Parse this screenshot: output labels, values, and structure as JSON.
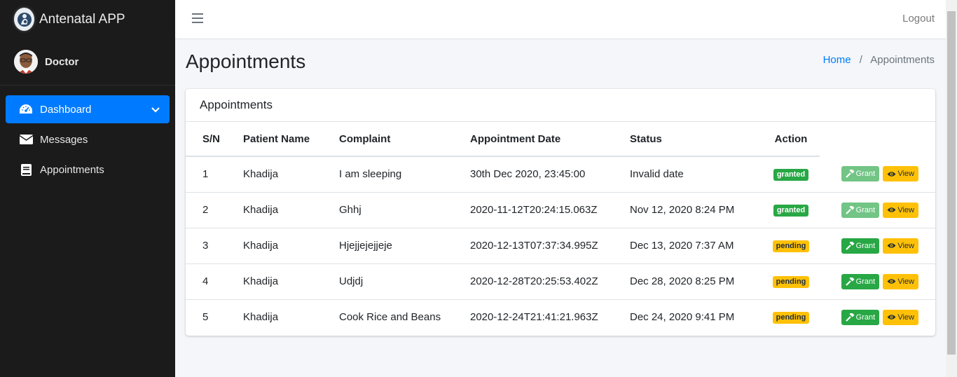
{
  "app": {
    "title": "Antenatal APP"
  },
  "user": {
    "name": "Doctor"
  },
  "sidebar": {
    "items": [
      {
        "label": "Dashboard",
        "icon": "tachometer-icon",
        "active": true
      },
      {
        "label": "Messages",
        "icon": "envelope-icon"
      },
      {
        "label": "Appointments",
        "icon": "book-icon"
      }
    ]
  },
  "navbar": {
    "logout_label": "Logout"
  },
  "page": {
    "title": "Appointments"
  },
  "breadcrumb": {
    "home": "Home",
    "separator": "/",
    "current": "Appointments"
  },
  "card": {
    "title": "Appointments"
  },
  "table": {
    "headers": [
      "S/N",
      "Patient Name",
      "Complaint",
      "Appointment Date",
      "Status",
      "Action"
    ],
    "rows": [
      {
        "sn": "1",
        "patient": "Khadija",
        "complaint": "I am sleeping",
        "date": "30th Dec 2020, 23:45:00",
        "status": "Invalid date",
        "badge": "granted",
        "grant_label": "Grant",
        "view_label": "View"
      },
      {
        "sn": "2",
        "patient": "Khadija",
        "complaint": "Ghhj",
        "date": "2020-11-12T20:24:15.063Z",
        "status": "Nov 12, 2020 8:24 PM",
        "badge": "granted",
        "grant_label": "Grant",
        "view_label": "View"
      },
      {
        "sn": "3",
        "patient": "Khadija",
        "complaint": "Hjejjejejjeje",
        "date": "2020-12-13T07:37:34.995Z",
        "status": "Dec 13, 2020 7:37 AM",
        "badge": "pending",
        "grant_label": "Grant",
        "view_label": "View"
      },
      {
        "sn": "4",
        "patient": "Khadija",
        "complaint": "Udjdj",
        "date": "2020-12-28T20:25:53.402Z",
        "status": "Dec 28, 2020 8:25 PM",
        "badge": "pending",
        "grant_label": "Grant",
        "view_label": "View"
      },
      {
        "sn": "5",
        "patient": "Khadija",
        "complaint": "Cook Rice and Beans",
        "date": "2020-12-24T21:41:21.963Z",
        "status": "Dec 24, 2020 9:41 PM",
        "badge": "pending",
        "grant_label": "Grant",
        "view_label": "View"
      }
    ]
  },
  "colors": {
    "primary": "#007bff",
    "success": "#28a745",
    "warning": "#ffc107",
    "sidebar": "#1b1b1b"
  }
}
